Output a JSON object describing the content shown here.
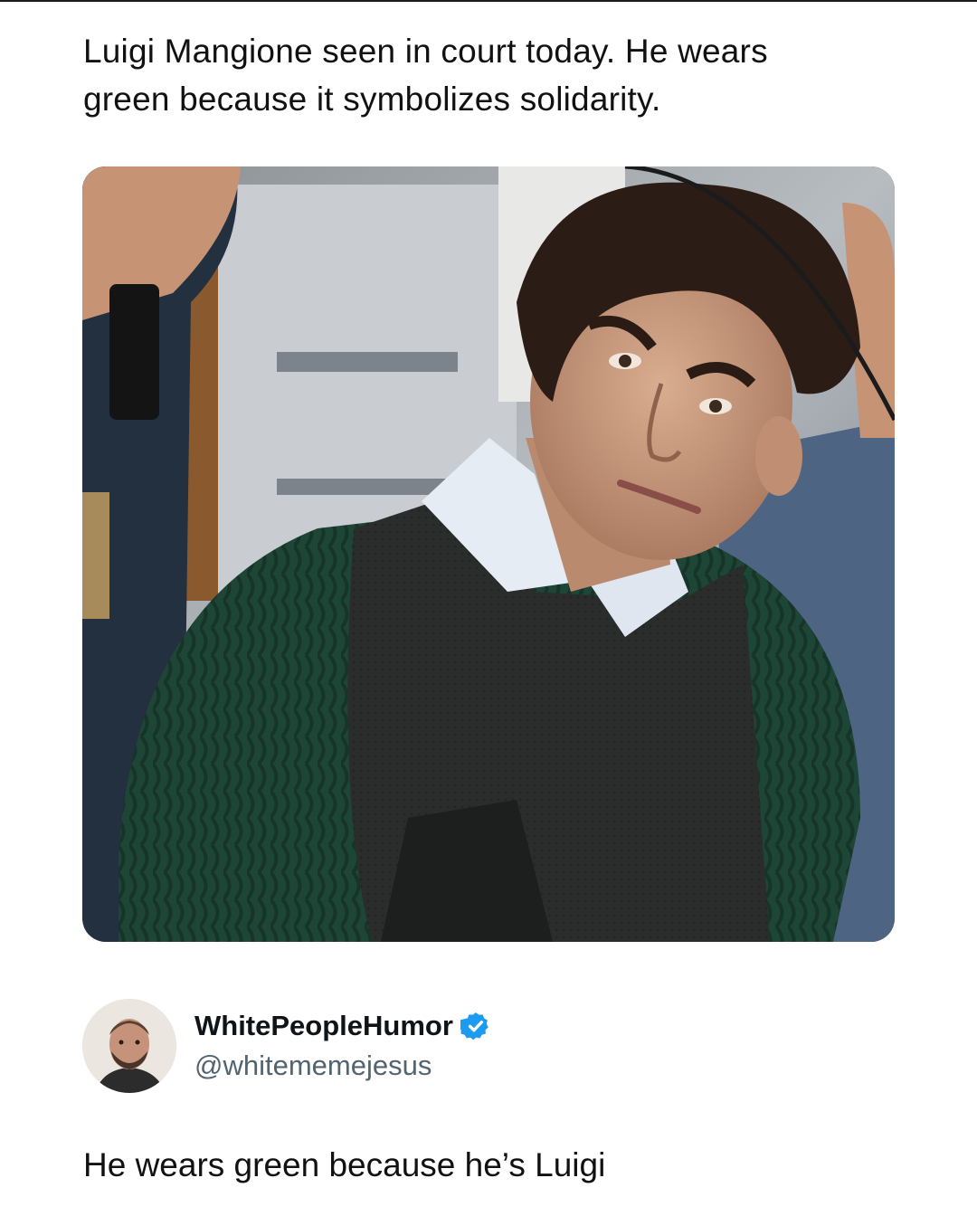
{
  "tweet": {
    "text_line1": "Luigi Mangione seen in court today. He wears",
    "text_line2": "green because it symbolizes solidarity."
  },
  "media": {
    "description_icon": "photo",
    "colors": {
      "sweater": "#1f4a3a",
      "vest": "#2a2c2b",
      "collar": "#e6ecf4",
      "skin": "#c99a7e",
      "hair": "#2b1d15"
    }
  },
  "author": {
    "display_name": "WhitePeopleHumor",
    "handle": "@whitememejesus",
    "verified_color": "#1d9bf0"
  },
  "reply": {
    "text": "He wears green because he’s Luigi"
  }
}
